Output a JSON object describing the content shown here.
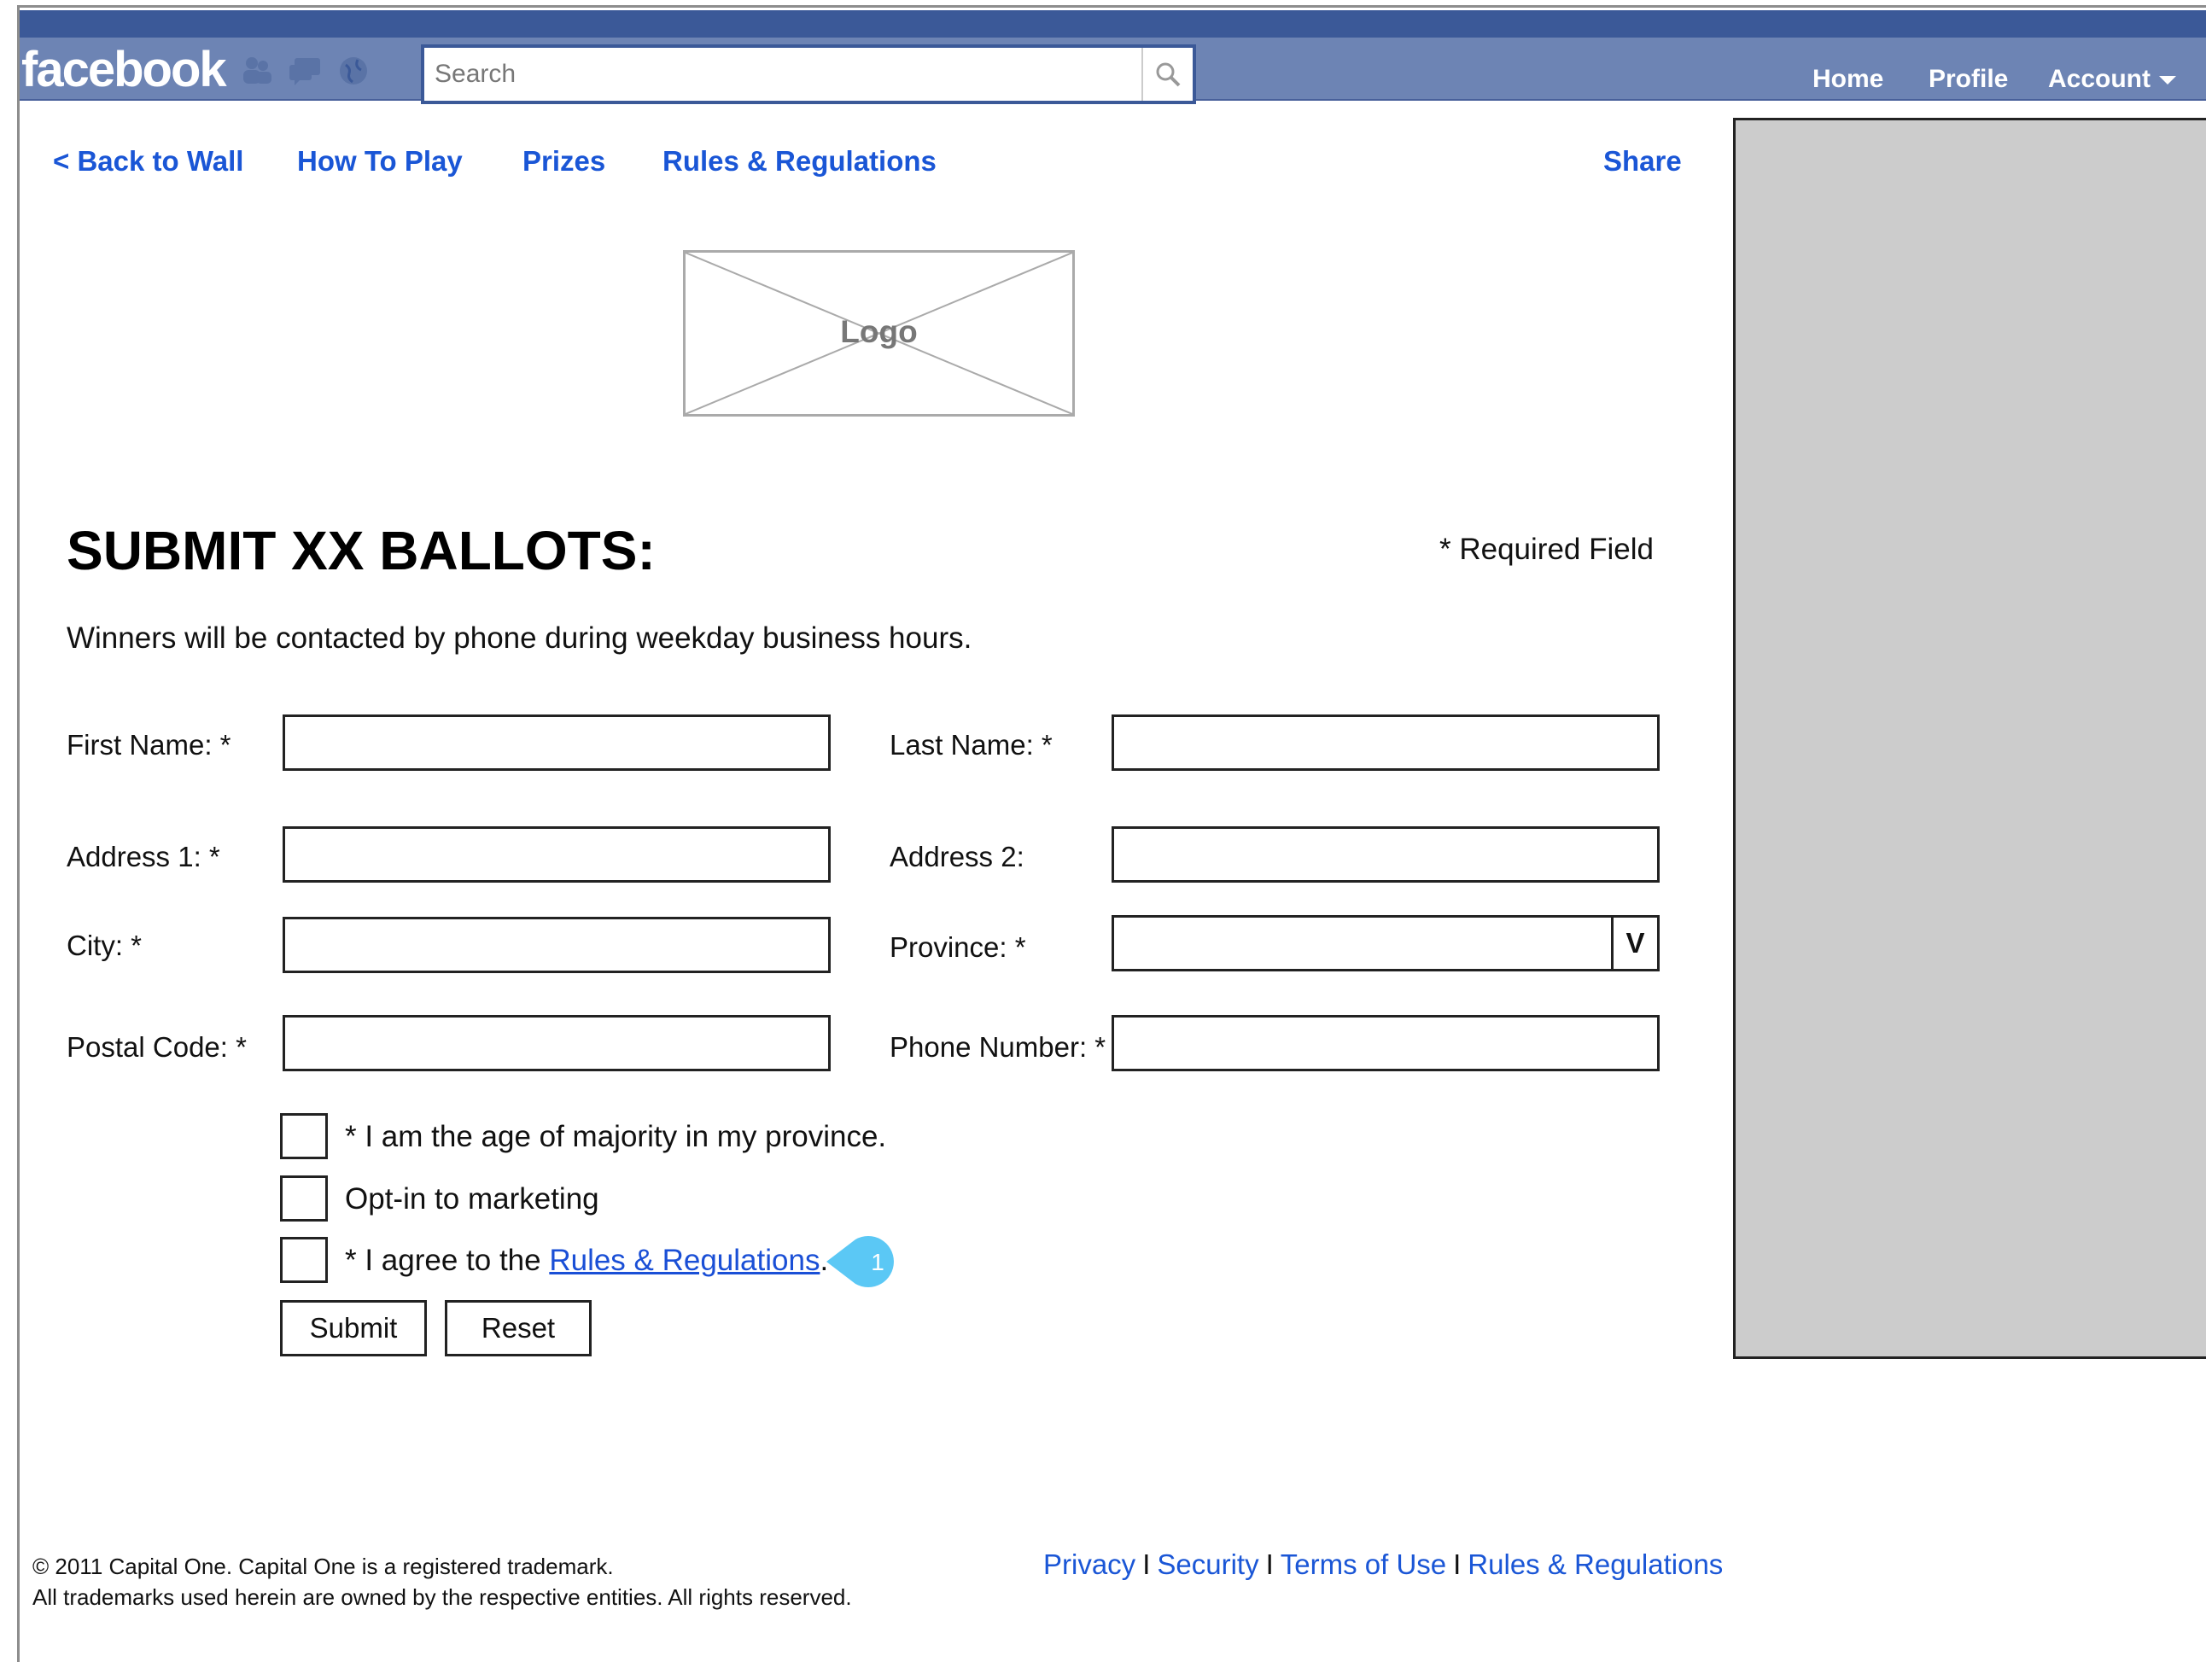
{
  "facebook_bar": {
    "logo": "facebook",
    "search_placeholder": "Search",
    "nav": {
      "home": "Home",
      "profile": "Profile",
      "account": "Account"
    },
    "colors": {
      "bar_dark": "#3b5998",
      "bar_light": "#6d84b4"
    }
  },
  "app_nav": {
    "back": "< Back to Wall",
    "how_to_play": "How To Play",
    "prizes": "Prizes",
    "rules": "Rules & Regulations",
    "share": "Share"
  },
  "logo_placeholder": "Logo",
  "form": {
    "title": "SUBMIT XX BALLOTS:",
    "required_note": "* Required Field",
    "intro": "Winners will be contacted by phone during weekday business hours.",
    "labels": {
      "first_name": "First Name: *",
      "last_name": "Last Name: *",
      "address1": "Address 1: *",
      "address2": "Address 2:",
      "city": "City: *",
      "province": "Province: *",
      "postal_code": "Postal Code: *",
      "phone": "Phone Number: *"
    },
    "province_dropdown_glyph": "V",
    "checkboxes": {
      "age": "* I am the age of majority in my province.",
      "marketing": "Opt-in to marketing",
      "agree_prefix": "* I agree to the ",
      "agree_link": "Rules & Regulations",
      "agree_suffix": "."
    },
    "buttons": {
      "submit": "Submit",
      "reset": "Reset"
    },
    "annotation_number": "1"
  },
  "footer": {
    "copyright_line1": "© 2011 Capital One. Capital One is a registered trademark.",
    "copyright_line2": "All trademarks used herein are owned by the respective entities. All rights reserved.",
    "separator": "I",
    "links": {
      "privacy": "Privacy",
      "security": "Security",
      "terms": "Terms of Use",
      "rules": "Rules & Regulations"
    }
  },
  "colors": {
    "link": "#1a56d6",
    "side_panel": "#cccccc",
    "annotation": "#5bc8f5"
  }
}
